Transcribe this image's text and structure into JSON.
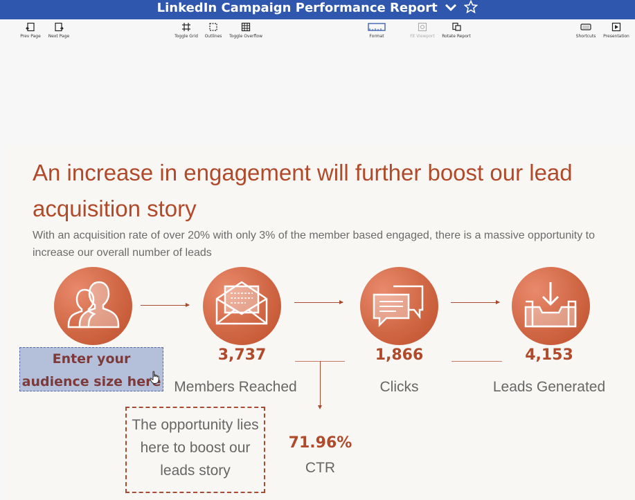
{
  "window": {
    "title": "LinkedIn Campaign Performance Report",
    "dropdown_icon": "chevron-down-icon",
    "favorite_icon": "star-icon"
  },
  "toolbar": {
    "prev_page": "Prev Page",
    "next_page": "Next Page",
    "toggle_grid": "Toggle Grid",
    "outlines": "Outlines",
    "toggle_overflow": "Toggle Overflow",
    "format": "Format",
    "fit_viewport": "Fit Viewport",
    "rotate_report": "Rotate Report",
    "shortcuts": "Shortcuts",
    "presentation": "Presentation"
  },
  "slide": {
    "headline": "An increase in engagement will further boost our lead acquisition story",
    "subtitle": "With an acquisition rate of over 20% with only 3% of the member based engaged, there is a massive opportunity to increase our overall number of leads",
    "audience_input": "Enter your audience size here",
    "members_reached_value": "3,737",
    "members_reached_label": "Members Reached",
    "clicks_value": "1,866",
    "clicks_label": "Clicks",
    "leads_value": "4,153",
    "leads_label": "Leads Generated",
    "opportunity_text": "The opportunity lies here to boost our leads story",
    "ctr_value": "71.96%",
    "ctr_label": "CTR"
  },
  "colors": {
    "accent": "#b04a2a",
    "titlebar": "#2f57ad",
    "input_bg": "#b4bfd9"
  }
}
